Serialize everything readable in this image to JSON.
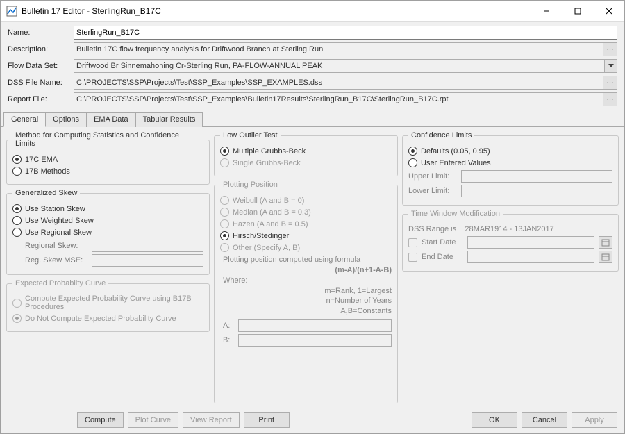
{
  "window": {
    "title": "Bulletin 17 Editor - SterlingRun_B17C"
  },
  "form": {
    "name_label": "Name:",
    "name_value": "SterlingRun_B17C",
    "description_label": "Description:",
    "description_value": "Bulletin 17C flow frequency analysis for Driftwood Branch at Sterling Run",
    "flow_dataset_label": "Flow Data Set:",
    "flow_dataset_value": "Driftwood Br Sinnemahoning Cr-Sterling Run, PA-FLOW-ANNUAL PEAK",
    "dss_file_label": "DSS File Name:",
    "dss_file_value": "C:\\PROJECTS\\SSP\\Projects\\Test\\SSP_Examples\\SSP_EXAMPLES.dss",
    "report_file_label": "Report File:",
    "report_file_value": "C:\\PROJECTS\\SSP\\Projects\\Test\\SSP_Examples\\Bulletin17Results\\SterlingRun_B17C\\SterlingRun_B17C.rpt"
  },
  "tabs": {
    "general": "General",
    "options": "Options",
    "ema_data": "EMA Data",
    "tabular_results": "Tabular Results"
  },
  "method_group": {
    "legend": "Method for Computing Statistics and Confidence Limits",
    "opt_17c": "17C EMA",
    "opt_17b": "17B Methods"
  },
  "skew_group": {
    "legend": "Generalized Skew",
    "opt_station": "Use Station Skew",
    "opt_weighted": "Use Weighted Skew",
    "opt_regional": "Use Regional Skew",
    "regional_skew_label": "Regional Skew:",
    "reg_skew_mse_label": "Reg. Skew MSE:"
  },
  "expected_group": {
    "legend": "Expected Probablity Curve",
    "opt_compute": "Compute Expected Probability Curve using B17B Procedures",
    "opt_donot": "Do Not Compute Expected Probability Curve"
  },
  "outlier_group": {
    "legend": "Low Outlier Test",
    "opt_multiple": "Multiple Grubbs-Beck",
    "opt_single": "Single Grubbs-Beck"
  },
  "plotting_group": {
    "legend": "Plotting Position",
    "opt_weibull": "Weibull (A and B = 0)",
    "opt_median": "Median (A and B = 0.3)",
    "opt_hazen": "Hazen (A and B = 0.5)",
    "opt_hirsch": "Hirsch/Stedinger",
    "opt_other": "Other (Specify A, B)",
    "formula_intro": "Plotting position computed using formula",
    "formula": "(m-A)/(n+1-A-B)",
    "where": "Where:",
    "line_m": "m=Rank, 1=Largest",
    "line_n": "n=Number of Years",
    "line_ab": "A,B=Constants",
    "a_label": "A:",
    "b_label": "B:"
  },
  "confidence_group": {
    "legend": "Confidence Limits",
    "opt_defaults": "Defaults (0.05, 0.95)",
    "opt_user": "User Entered Values",
    "upper_label": "Upper Limit:",
    "lower_label": "Lower Limit:"
  },
  "time_window_group": {
    "legend": "Time Window Modification",
    "range_prefix": "DSS Range is",
    "range_value": "28MAR1914 - 13JAN2017",
    "start_label": "Start Date",
    "end_label": "End Date"
  },
  "buttons": {
    "compute": "Compute",
    "plot_curve": "Plot Curve",
    "view_report": "View Report",
    "print": "Print",
    "ok": "OK",
    "cancel": "Cancel",
    "apply": "Apply"
  }
}
